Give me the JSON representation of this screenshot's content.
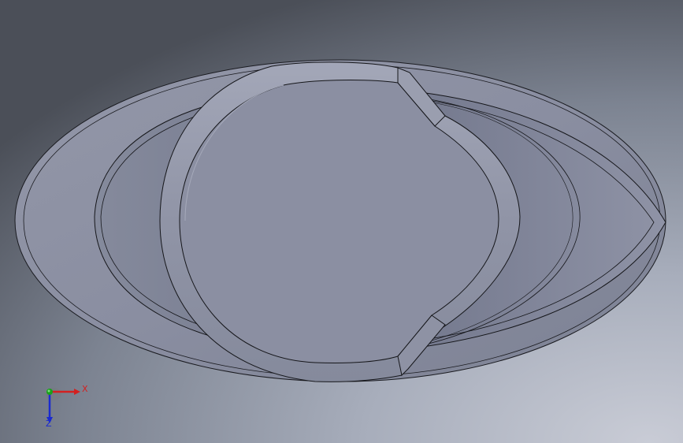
{
  "viewport": {
    "background_top": "#a7adbb",
    "background_dark": "#4b4f58",
    "part_fill": "#8c90a3",
    "part_shadow": "#6f7486",
    "edge_color": "#101114"
  },
  "triad": {
    "x_label": "X",
    "z_label": "Z",
    "x_color": "#d32020",
    "y_color": "#1aa21a",
    "z_color": "#1a2ad0"
  }
}
